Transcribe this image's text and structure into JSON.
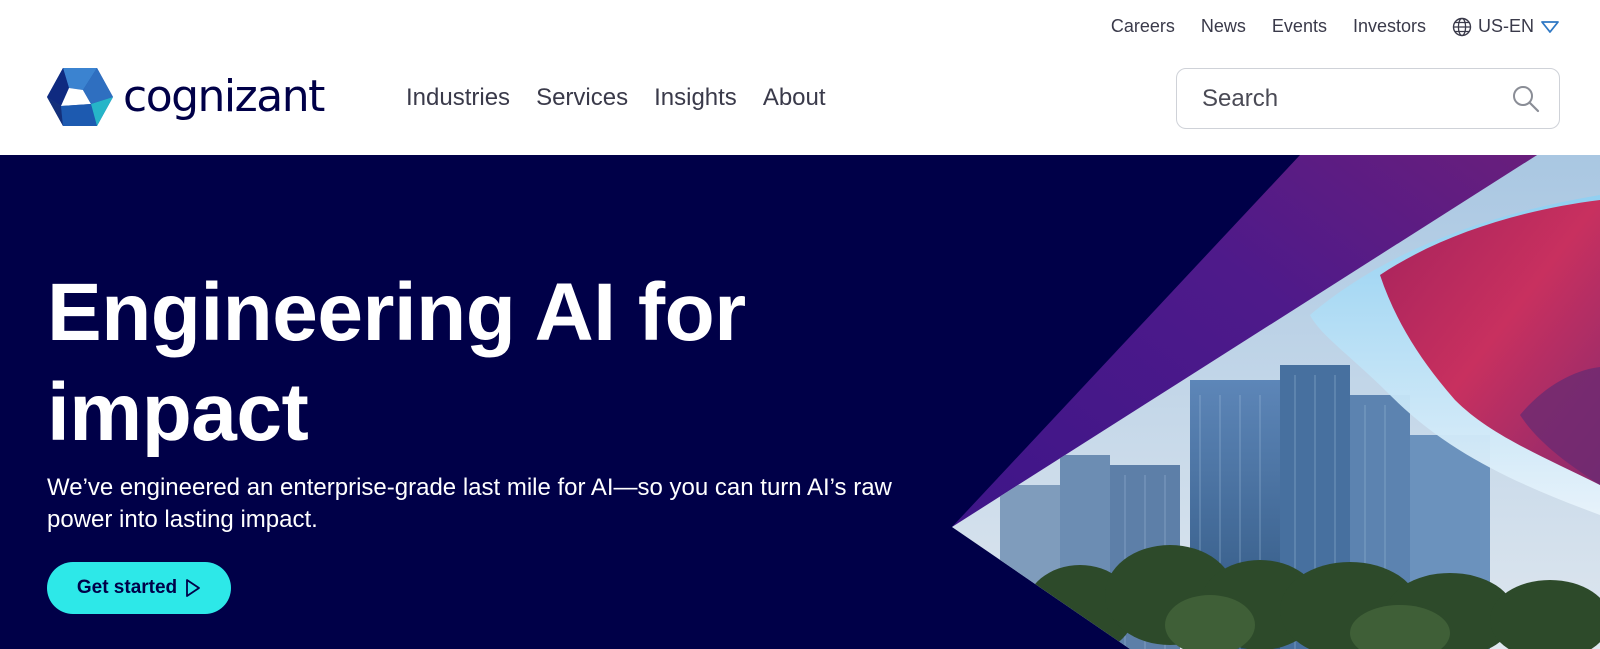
{
  "utility_nav": {
    "items": [
      "Careers",
      "News",
      "Events",
      "Investors"
    ],
    "locale": "US-EN"
  },
  "brand": {
    "name": "cognizant",
    "colors": {
      "navy": "#000048",
      "logo_light_blue": "#2f78c4",
      "logo_blue": "#1a4aa0",
      "logo_dark": "#0d1f72",
      "logo_teal": "#26b5c8",
      "cta_cyan": "#2de8e8",
      "hero_purple": "#4a1680",
      "hero_magenta": "#c8235e"
    }
  },
  "main_nav": {
    "items": [
      "Industries",
      "Services",
      "Insights",
      "About"
    ]
  },
  "search": {
    "placeholder": "Search",
    "icon": "search-icon"
  },
  "hero": {
    "title": "Engineering AI for impact",
    "subtitle": "We’ve engineered an enterprise-grade last mile for AI—so you can turn AI’s raw power into lasting impact.",
    "cta_label": "Get started",
    "cta_icon": "play-triangle-icon",
    "image": "city-skyline-photo"
  }
}
